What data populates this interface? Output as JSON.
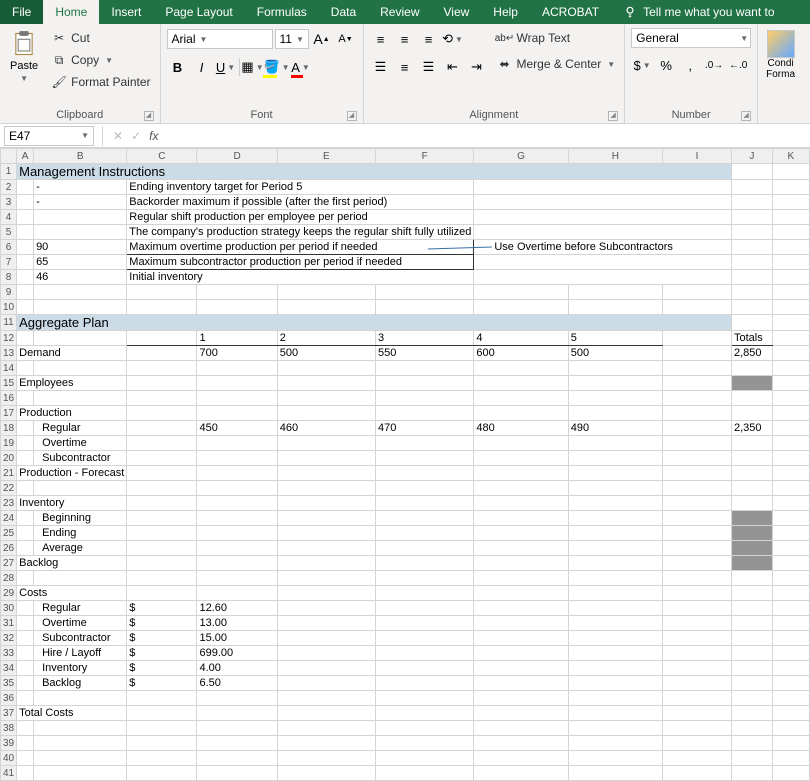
{
  "menu": {
    "file": "File",
    "home": "Home",
    "insert": "Insert",
    "page_layout": "Page Layout",
    "formulas": "Formulas",
    "data": "Data",
    "review": "Review",
    "view": "View",
    "help": "Help",
    "acrobat": "ACROBAT",
    "tell_me": "Tell me what you want to"
  },
  "ribbon": {
    "clipboard": {
      "paste": "Paste",
      "cut": "Cut",
      "copy": "Copy",
      "painter": "Format Painter",
      "label": "Clipboard"
    },
    "font": {
      "name": "Arial",
      "size": "11",
      "label": "Font"
    },
    "alignment": {
      "wrap": "Wrap Text",
      "merge": "Merge & Center",
      "label": "Alignment"
    },
    "number": {
      "format": "General",
      "label": "Number"
    },
    "cond": {
      "label1": "Condi",
      "label2": "Forma"
    }
  },
  "namebox": "E47",
  "sheet": {
    "cols": [
      "A",
      "B",
      "C",
      "D",
      "E",
      "F",
      "G",
      "H",
      "I",
      "J",
      "K"
    ],
    "rows": [
      {
        "n": 1,
        "section": "Management Instructions"
      },
      {
        "n": 2,
        "b": "-",
        "text": "Ending inventory target for Period 5"
      },
      {
        "n": 3,
        "b": "-",
        "text": "Backorder maximum if possible (after the first period)"
      },
      {
        "n": 4,
        "text": "Regular shift production per employee per period"
      },
      {
        "n": 5,
        "text": "The company's production strategy keeps the regular shift fully utilized"
      },
      {
        "n": 6,
        "b": "90",
        "text": "Maximum overtime production per period if needed",
        "callout": "Use Overtime before Subcontractors"
      },
      {
        "n": 7,
        "b": "65",
        "text": "Maximum subcontractor production per period if needed"
      },
      {
        "n": 8,
        "b": "46",
        "text": "Initial inventory"
      },
      {
        "n": 9
      },
      {
        "n": 10
      },
      {
        "n": 11,
        "section": "Aggregate Plan"
      },
      {
        "n": 12,
        "hdr": true,
        "vals": [
          "",
          "1",
          "2",
          "3",
          "4",
          "5",
          "",
          "Totals"
        ]
      },
      {
        "n": 13,
        "a": "Demand",
        "vals": [
          "700",
          "500",
          "550",
          "600",
          "500",
          "",
          "2,850"
        ]
      },
      {
        "n": 14
      },
      {
        "n": 15,
        "a": "Employees",
        "grey": {
          "tot": true
        }
      },
      {
        "n": 16
      },
      {
        "n": 17,
        "a": "Production"
      },
      {
        "n": 18,
        "sub": "Regular",
        "vals": [
          "450",
          "460",
          "470",
          "480",
          "490",
          "",
          "2,350"
        ]
      },
      {
        "n": 19,
        "sub": "Overtime"
      },
      {
        "n": 20,
        "sub": "Subcontractor"
      },
      {
        "n": 21,
        "a": "Production - Forecast"
      },
      {
        "n": 22
      },
      {
        "n": 23,
        "a": "Inventory"
      },
      {
        "n": 24,
        "sub": "Beginning",
        "grey": {
          "tot": true
        }
      },
      {
        "n": 25,
        "sub": "Ending",
        "grey": {
          "tot": true
        }
      },
      {
        "n": 26,
        "sub": "Average",
        "grey": {
          "tot": true
        }
      },
      {
        "n": 27,
        "a": "Backlog",
        "grey": {
          "tot": true
        }
      },
      {
        "n": 28
      },
      {
        "n": 29,
        "a": "Costs"
      },
      {
        "n": 30,
        "sub": "Regular",
        "dollar": "$",
        "amt": "12.60"
      },
      {
        "n": 31,
        "sub": "Overtime",
        "dollar": "$",
        "amt": "13.00"
      },
      {
        "n": 32,
        "sub": "Subcontractor",
        "dollar": "$",
        "amt": "15.00"
      },
      {
        "n": 33,
        "sub": "Hire / Layoff",
        "dollar": "$",
        "amt": "699.00"
      },
      {
        "n": 34,
        "sub": "Inventory",
        "dollar": "$",
        "amt": "4.00"
      },
      {
        "n": 35,
        "sub": "Backlog",
        "dollar": "$",
        "amt": "6.50"
      },
      {
        "n": 36
      },
      {
        "n": 37,
        "a": "Total Costs"
      },
      {
        "n": 38
      },
      {
        "n": 39
      },
      {
        "n": 40
      },
      {
        "n": 41
      }
    ]
  }
}
